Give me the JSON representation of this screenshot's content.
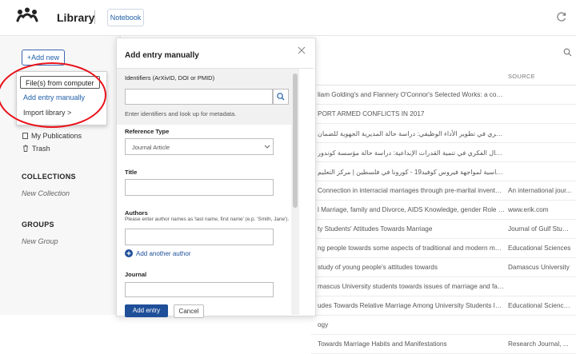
{
  "app": {
    "title": "Library",
    "notebook_button": "Notebook"
  },
  "sidebar": {
    "add_new_label": "+Add new",
    "menu": {
      "items": [
        "File(s) from computer",
        "Add entry manually",
        "Import library >"
      ]
    },
    "nav": [
      "My Publications",
      "Trash"
    ],
    "collections": {
      "heading": "COLLECTIONS",
      "new_label": "New Collection"
    },
    "groups": {
      "heading": "GROUPS",
      "new_label": "New Group"
    }
  },
  "dialog": {
    "title": "Add entry manually",
    "identifiers": {
      "label": "Identifiers (ArXivID, DOI or PMID)",
      "value": "",
      "hint": "Enter identifiers and look up for metadata."
    },
    "reference_type": {
      "label": "Reference Type",
      "value": "Journal Article"
    },
    "title_field": {
      "label": "Title",
      "value": ""
    },
    "authors": {
      "label": "Authors",
      "hint": "Please enter author names as 'last name, first name' (e.p. 'Smith, Jane').",
      "value": "",
      "add_another": "Add another author"
    },
    "journal": {
      "label": "Journal",
      "value": ""
    },
    "add_entry_button": "Add entry",
    "cancel_button": "Cancel"
  },
  "list": {
    "source_header": "SOURCE",
    "rows": [
      {
        "title": "liam Golding's and Flannery O'Connor's Selected Works: a contrastiv...",
        "source": ""
      },
      {
        "title": "PORT ARMED CONFLICTS IN 2017",
        "source": ""
      },
      {
        "title": "دور رأس المال الفكري في تطوير الأداء الوظيفي: دراسة حالة المديرية الجهوية للضمان",
        "source": ""
      },
      {
        "title": "دور الاستثمار في رأس المال الفكري في تنمية القدرات الإبداعية: دراسة حالة مؤسسة كوندور",
        "source": ""
      },
      {
        "title": "قرارات ومراسيم رئاسية لمواجهة فيروس كوفيد19 - كورونا في فلسطين | مركز التعليم",
        "source": ""
      },
      {
        "title": "Connection in interracial marriages through pre-marital inventories: A ...",
        "source": "An international jour..."
      },
      {
        "title": "l Marriage, family and Divorce, AIDS Knowledge, gender Role identit...",
        "source": "www.erik.com"
      },
      {
        "title": "ty Students' Attitudes Towards Marriage",
        "source": "Journal of Gulf Studi..."
      },
      {
        "title": "ng people towards some aspects of traditional and modern marriage:...",
        "source": "Educational Sciences"
      },
      {
        "title": "study of young people's attitudes towards",
        "source": "Damascus University"
      },
      {
        "title": "mascus University students towards issues of marriage and family pla...",
        "source": ""
      },
      {
        "title": "udes Towards Relative Marriage Among University Students In The U...",
        "source": "Educational Science..."
      },
      {
        "title": "ogy",
        "source": ""
      },
      {
        "title": "Towards Marriage Habits and Manifestations",
        "source": "Research Journal, ..."
      }
    ]
  },
  "colors": {
    "accent": "#1f5faa",
    "primary_button": "#1f4f99",
    "annotation": "#e8111a"
  },
  "icons": [
    "mendeley-logo-icon",
    "sync-icon",
    "search-icon",
    "close-icon",
    "chevron-down-icon",
    "plus-circle-icon",
    "trash-icon",
    "publications-icon"
  ]
}
